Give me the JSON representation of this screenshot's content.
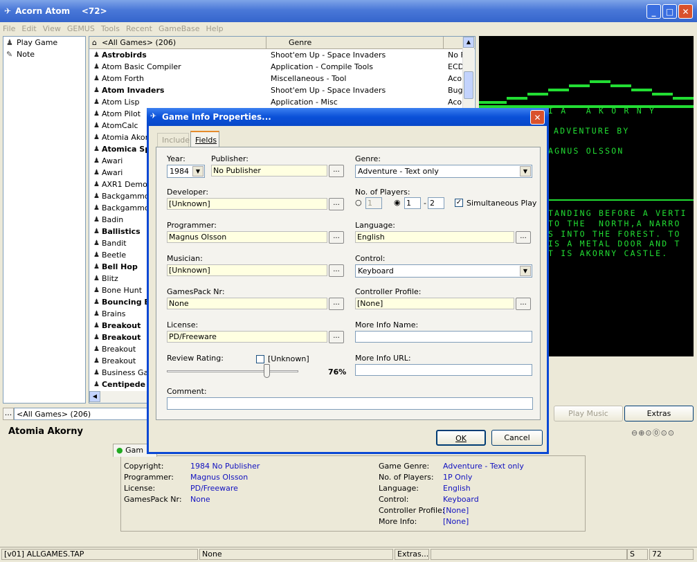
{
  "window": {
    "title": "Acorn Atom    <72>"
  },
  "menu": [
    "File",
    "Edit",
    "View",
    "GEMUS",
    "Tools",
    "Recent",
    "GameBase",
    "Help"
  ],
  "left_tree": [
    {
      "label": "Play Game",
      "icon": "joystick-icon"
    },
    {
      "label": "Note",
      "icon": "note-icon"
    }
  ],
  "list": {
    "header_all": "<All Games>  (206)",
    "col_genre": "Genre",
    "rows": [
      {
        "name": "Astrobirds",
        "genre": "Shoot'em Up - Space Invaders",
        "extra": "No F",
        "bold": true
      },
      {
        "name": "Atom Basic Compiler",
        "genre": "Application - Compile Tools",
        "extra": "ECD",
        "bold": false
      },
      {
        "name": "Atom Forth",
        "genre": "Miscellaneous - Tool",
        "extra": "Aco",
        "bold": false
      },
      {
        "name": "Atom Invaders",
        "genre": "Shoot'em Up - Space Invaders",
        "extra": "Bug",
        "bold": true
      },
      {
        "name": "Atom Lisp",
        "genre": "Application - Misc",
        "extra": "Aco",
        "bold": false
      },
      {
        "name": "Atom Pilot",
        "genre": "",
        "extra": "",
        "bold": false
      },
      {
        "name": "AtomCalc",
        "genre": "",
        "extra": "",
        "bold": false
      },
      {
        "name": "Atomia Akorn",
        "genre": "",
        "extra": "",
        "bold": false
      },
      {
        "name": "Atomica Sp",
        "genre": "",
        "extra": "",
        "bold": true
      },
      {
        "name": "Awari",
        "genre": "",
        "extra": "",
        "bold": false
      },
      {
        "name": "Awari",
        "genre": "",
        "extra": "",
        "bold": false
      },
      {
        "name": "AXR1 Demo",
        "genre": "",
        "extra": "",
        "bold": false
      },
      {
        "name": "Backgammo",
        "genre": "",
        "extra": "",
        "bold": false
      },
      {
        "name": "Backgammo",
        "genre": "",
        "extra": "",
        "bold": false
      },
      {
        "name": "Badin",
        "genre": "",
        "extra": "",
        "bold": false
      },
      {
        "name": "Ballistics",
        "genre": "",
        "extra": "",
        "bold": true
      },
      {
        "name": "Bandit",
        "genre": "",
        "extra": "",
        "bold": false
      },
      {
        "name": "Beetle",
        "genre": "",
        "extra": "",
        "bold": false
      },
      {
        "name": "Bell Hop",
        "genre": "",
        "extra": "",
        "bold": true
      },
      {
        "name": "Blitz",
        "genre": "",
        "extra": "",
        "bold": false
      },
      {
        "name": "Bone Hunt",
        "genre": "",
        "extra": "",
        "bold": false
      },
      {
        "name": "Bouncing B",
        "genre": "",
        "extra": "",
        "bold": true
      },
      {
        "name": "Brains",
        "genre": "",
        "extra": "",
        "bold": false
      },
      {
        "name": "Breakout",
        "genre": "",
        "extra": "",
        "bold": true
      },
      {
        "name": "Breakout",
        "genre": "",
        "extra": "",
        "bold": true
      },
      {
        "name": "Breakout",
        "genre": "",
        "extra": "",
        "bold": false
      },
      {
        "name": "Breakout",
        "genre": "",
        "extra": "",
        "bold": false
      },
      {
        "name": "Business Ga",
        "genre": "",
        "extra": "",
        "bold": false
      },
      {
        "name": "Centipede",
        "genre": "",
        "extra": "",
        "bold": true
      }
    ]
  },
  "screen": {
    "line1": "I A   A K O R N Y",
    "line2": "ADVENTURE BY",
    "line3": "AGNUS OLSSON",
    "para": [
      "TANDING BEFORE A VERTI",
      "TO THE  NORTH,A NARRO",
      "S INTO THE FOREST. TO",
      "IS A METAL DOOR AND T",
      "T IS AKORNY CASTLE."
    ]
  },
  "filter_bar": {
    "dots": "...",
    "value": "<All Games>  (206)"
  },
  "buttons_right": {
    "play_music": "Play Music",
    "extras": "Extras"
  },
  "game_title": "Atomia Akorny",
  "info": {
    "tab": "Gam",
    "left": [
      [
        "Copyright:",
        "1984 No Publisher"
      ],
      [
        "Programmer:",
        "Magnus Olsson"
      ],
      [
        "License:",
        "PD/Freeware"
      ],
      [
        "GamesPack Nr:",
        "None"
      ]
    ],
    "right": [
      [
        "Game Genre:",
        "Adventure - Text only"
      ],
      [
        "No. of Players:",
        "1P Only"
      ],
      [
        "Language:",
        "English"
      ],
      [
        "Control:",
        "Keyboard"
      ],
      [
        "Controller Profile:",
        "[None]"
      ],
      [
        "More Info:",
        "[None]"
      ]
    ]
  },
  "status": {
    "file": "[v01] ALLGAMES.TAP",
    "value": "None",
    "extras": "Extras...",
    "s": "S",
    "num": "72"
  },
  "dialog": {
    "title": "Game Info Properties...",
    "tab_include": "Include",
    "tab_fields": "Fields",
    "year_label": "Year:",
    "year": "1984",
    "publisher_label": "Publisher:",
    "publisher": "No Publisher",
    "genre_label": "Genre:",
    "genre": "Adventure - Text only",
    "developer_label": "Developer:",
    "developer": "[Unknown]",
    "players_label": "No. of Players:",
    "players_min": "1",
    "players_from": "1",
    "players_to": "2",
    "players_dash": "-",
    "simultaneous": "Simultaneous Play",
    "programmer_label": "Programmer:",
    "programmer": "Magnus Olsson",
    "language_label": "Language:",
    "language": "English",
    "musician_label": "Musician:",
    "musician": "[Unknown]",
    "control_label": "Control:",
    "control": "Keyboard",
    "gamespack_label": "GamesPack Nr:",
    "gamespack": "None",
    "profile_label": "Controller Profile:",
    "profile": "[None]",
    "license_label": "License:",
    "license": "PD/Freeware",
    "moreinfo_name_label": "More Info Name:",
    "moreinfo_name": "",
    "rating_label": "Review Rating:",
    "rating_unknown": "[Unknown]",
    "rating_value": "76%",
    "rating_fraction": 0.76,
    "moreinfo_url_label": "More Info URL:",
    "moreinfo_url": "",
    "comment_label": "Comment:",
    "comment": "",
    "ok": "OK",
    "cancel": "Cancel",
    "dots": "..."
  }
}
